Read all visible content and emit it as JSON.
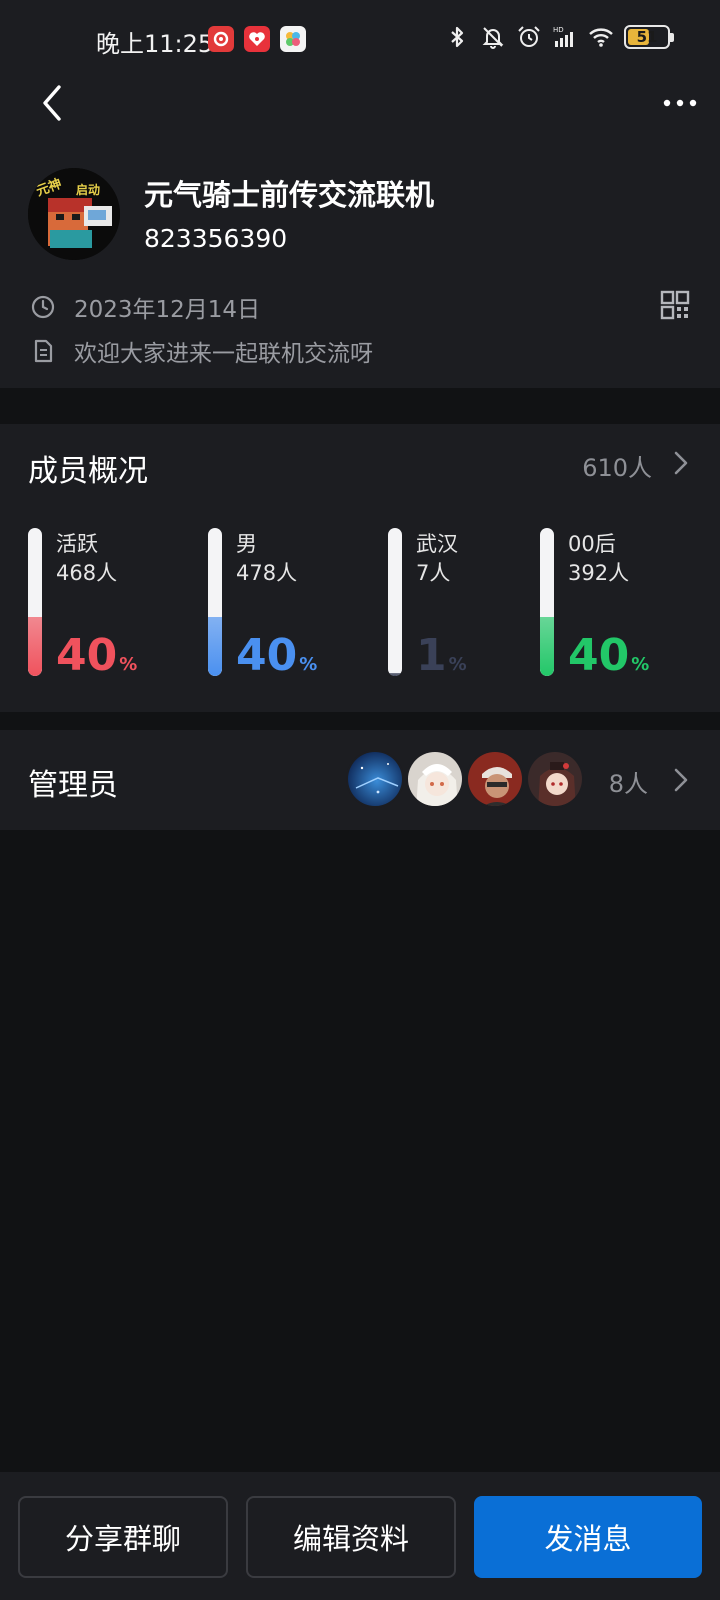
{
  "status_bar": {
    "time": "晚上11:25",
    "battery": "51",
    "icons": [
      "netease-music-icon",
      "app-red-icon",
      "app-multicolor-icon",
      "bluetooth-icon",
      "bell-off-icon",
      "alarm-icon",
      "signal-icon",
      "wifi-icon",
      "battery-icon"
    ]
  },
  "group": {
    "name": "元气骑士前传交流联机",
    "id": "823356390",
    "created_date": "2023年12月14日",
    "description": "欢迎大家进来一起联机交流呀",
    "avatar_text": "元神，启动！"
  },
  "members": {
    "title": "成员概况",
    "count": "610人",
    "stats": [
      {
        "label": "活跃",
        "count": "468人",
        "percent": "40",
        "fill": 0.4,
        "color": "#f0525d",
        "fill_color": "#f0525d"
      },
      {
        "label": "男",
        "count": "478人",
        "percent": "40",
        "fill": 0.4,
        "color": "#4a90f0",
        "fill_color": "#4a90f0"
      },
      {
        "label": "武汉",
        "count": "7人",
        "percent": "1",
        "fill": 0.01,
        "color": "#3a4158",
        "fill_color": "#3a4158"
      },
      {
        "label": "00后",
        "count": "392人",
        "percent": "40",
        "fill": 0.4,
        "color": "#22c768",
        "fill_color": "#22c768"
      }
    ],
    "percent_unit": "%"
  },
  "admins": {
    "title": "管理员",
    "count": "8人"
  },
  "actions": {
    "share": "分享群聊",
    "edit": "编辑资料",
    "send": "发消息"
  },
  "colors": {
    "background": "#111214",
    "card": "#1c1d21",
    "primary": "#0a6fd6"
  }
}
